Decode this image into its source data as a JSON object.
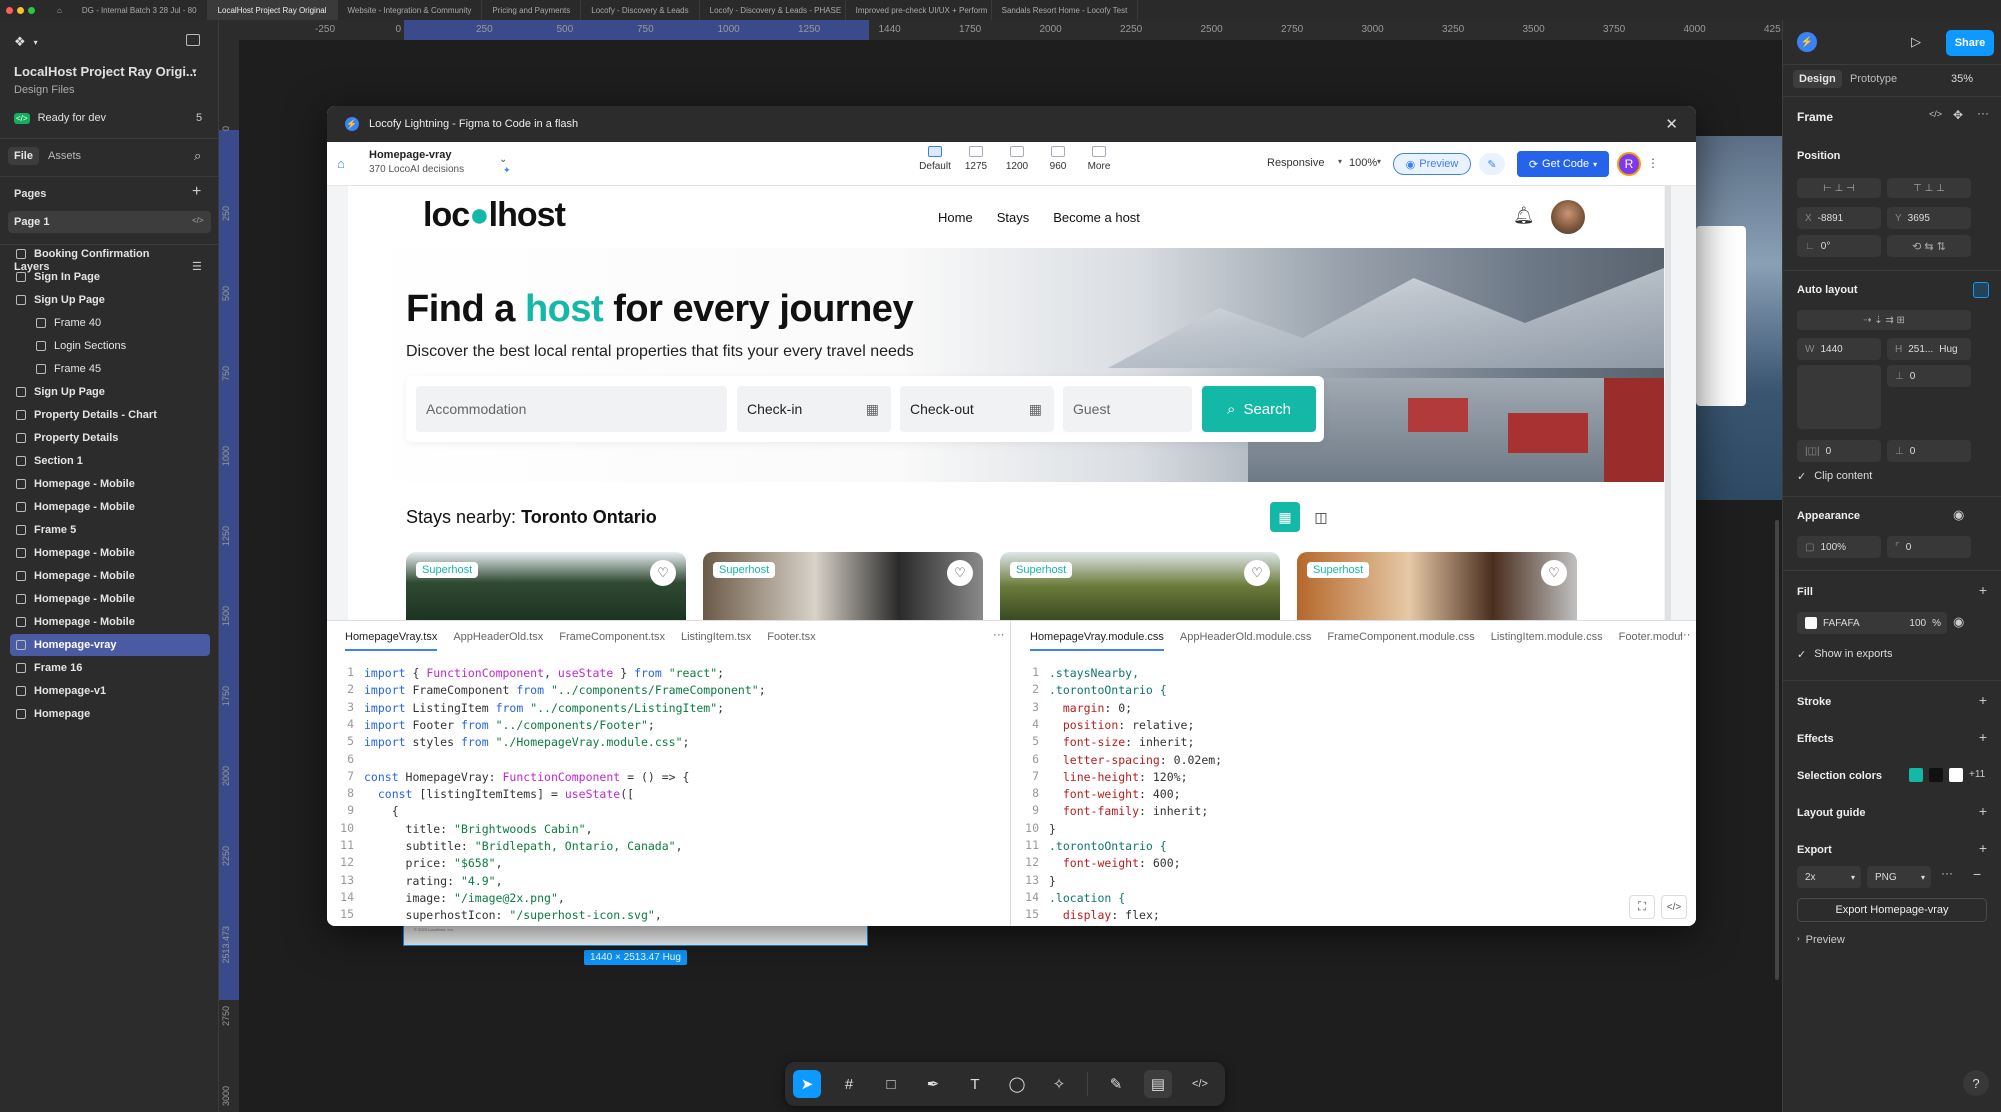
{
  "browser_tabs": [
    "DG - Internal Batch 3 28 Jul - 80",
    "LocalHost Project Ray Original",
    "Website - Integration & Community",
    "Pricing and Payments",
    "Locofy - Discovery & Leads",
    "Locofy - Discovery & Leads - PHASE",
    "Improved pre-check UI/UX + Perform",
    "Sandals Resort Home - Locofy Test"
  ],
  "file": {
    "name": "LocalHost Project Ray Origi...",
    "subtitle": "Design Files",
    "ready_label": "Ready for dev",
    "ready_count": "5",
    "tab_file": "File",
    "tab_assets": "Assets",
    "pages_label": "Pages",
    "page_1": "Page 1",
    "layers_label": "Layers"
  },
  "layers": [
    {
      "name": "Booking Confirmation",
      "sub": false
    },
    {
      "name": "Sign In Page",
      "sub": false
    },
    {
      "name": "Sign Up Page",
      "sub": false
    },
    {
      "name": "Frame 40",
      "sub": true
    },
    {
      "name": "Login Sections",
      "sub": true
    },
    {
      "name": "Frame 45",
      "sub": true
    },
    {
      "name": "Sign Up Page",
      "sub": false
    },
    {
      "name": "Property Details - Chart",
      "sub": false
    },
    {
      "name": "Property Details",
      "sub": false
    },
    {
      "name": "Section 1",
      "sub": false
    },
    {
      "name": "Homepage - Mobile",
      "sub": false
    },
    {
      "name": "Homepage - Mobile",
      "sub": false
    },
    {
      "name": "Frame 5",
      "sub": false
    },
    {
      "name": "Homepage - Mobile",
      "sub": false
    },
    {
      "name": "Homepage - Mobile",
      "sub": false
    },
    {
      "name": "Homepage - Mobile",
      "sub": false
    },
    {
      "name": "Homepage - Mobile",
      "sub": false
    },
    {
      "name": "Homepage-vray",
      "sub": false,
      "selected": true
    },
    {
      "name": "Frame 16",
      "sub": false
    },
    {
      "name": "Homepage-v1",
      "sub": false
    },
    {
      "name": "Homepage",
      "sub": false
    }
  ],
  "ruler": [
    "-250",
    "0",
    "250",
    "500",
    "750",
    "1000",
    "1250",
    "1440",
    "1750",
    "2000",
    "2250",
    "2500",
    "2750",
    "3000",
    "3250",
    "3500",
    "3750",
    "4000",
    "425"
  ],
  "vruler": [
    "0",
    "250",
    "500",
    "750",
    "1000",
    "1250",
    "1500",
    "1750",
    "2000",
    "2250",
    "2513.473",
    "2750",
    "3000"
  ],
  "plugin": {
    "title": "Locofy Lightning - Figma to Code in a flash",
    "page_name": "Homepage-vray",
    "decisions": "370 LocoAI decisions",
    "breakpoints": [
      "Default",
      "1275",
      "1200",
      "960",
      "More"
    ],
    "responsive": "Responsive",
    "zoom": "100%",
    "preview_btn": "Preview",
    "get_code_btn": "Get Code",
    "avatar_letter": "R"
  },
  "site": {
    "logo_pre": "loc",
    "logo_post": "lhost",
    "nav": [
      "Home",
      "Stays",
      "Become a host"
    ],
    "hero_title_pre": "Find a ",
    "hero_title_accent": "host",
    "hero_title_post": " for every journey",
    "hero_sub": "Discover the best local rental properties that fits your every travel needs",
    "search": {
      "accommodation": "Accommodation",
      "checkin": "Check-in",
      "checkout": "Check-out",
      "guest": "Guest",
      "button": "Search"
    },
    "nearby_label": "Stays nearby: ",
    "nearby_place": "Toronto Ontario",
    "card_badge": "Superhost",
    "accent": "#14b8a6"
  },
  "code_left": {
    "tabs": [
      "HomepageVray.tsx",
      "AppHeaderOld.tsx",
      "FrameComponent.tsx",
      "ListingItem.tsx",
      "Footer.tsx"
    ],
    "lines": [
      "import { FunctionComponent, useState } from \"react\";",
      "import FrameComponent from \"../components/FrameComponent\";",
      "import ListingItem from \"../components/ListingItem\";",
      "import Footer from \"../components/Footer\";",
      "import styles from \"./HomepageVray.module.css\";",
      "",
      "const HomepageVray: FunctionComponent = () => {",
      "  const [listingItemItems] = useState([",
      "    {",
      "      title: \"Brightwoods Cabin\",",
      "      subtitle: \"Bridlepath, Ontario, Canada\",",
      "      price: \"$658\",",
      "      rating: \"4.9\",",
      "      image: \"/image@2x.png\",",
      "      superhostIcon: \"/superhost-icon.svg\","
    ]
  },
  "code_right": {
    "tabs": [
      "HomepageVray.module.css",
      "AppHeaderOld.module.css",
      "FrameComponent.module.css",
      "ListingItem.module.css",
      "Footer.modul"
    ],
    "lines": [
      ".staysNearby,",
      ".torontoOntario {",
      "  margin: 0;",
      "  position: relative;",
      "  font-size: inherit;",
      "  letter-spacing: 0.02em;",
      "  line-height: 120%;",
      "  font-weight: 400;",
      "  font-family: inherit;",
      "}",
      ".torontoOntario {",
      "  font-weight: 600;",
      "}",
      ".location {",
      "  display: flex;"
    ]
  },
  "frame_size_label": "1440 × 2513.47 Hug",
  "right_panel": {
    "share": "Share",
    "tab_design": "Design",
    "tab_prototype": "Prototype",
    "zoom": "35%",
    "frame_label": "Frame",
    "position_label": "Position",
    "x_label": "X",
    "x_value": "-8891",
    "y_label": "Y",
    "y_value": "3695",
    "rotation": "0°",
    "auto_layout_label": "Auto layout",
    "w_label": "W",
    "w_value": "1440",
    "h_label": "H",
    "h_value": "251...",
    "h_mode": "Hug",
    "gap": "0",
    "pad_h": "0",
    "pad_v": "0",
    "clip_label": "Clip content",
    "appearance_label": "Appearance",
    "opacity": "100%",
    "radius": "0",
    "fill_label": "Fill",
    "fill_hex": "FAFAFA",
    "fill_opacity": "100",
    "fill_pct": "%",
    "show_exports": "Show in exports",
    "stroke_label": "Stroke",
    "effects_label": "Effects",
    "selection_colors_label": "Selection colors",
    "selection_more": "+11",
    "layout_guide_label": "Layout guide",
    "export_label": "Export",
    "export_scale": "2x",
    "export_format": "PNG",
    "export_button": "Export Homepage-vray",
    "preview_label": "Preview"
  }
}
